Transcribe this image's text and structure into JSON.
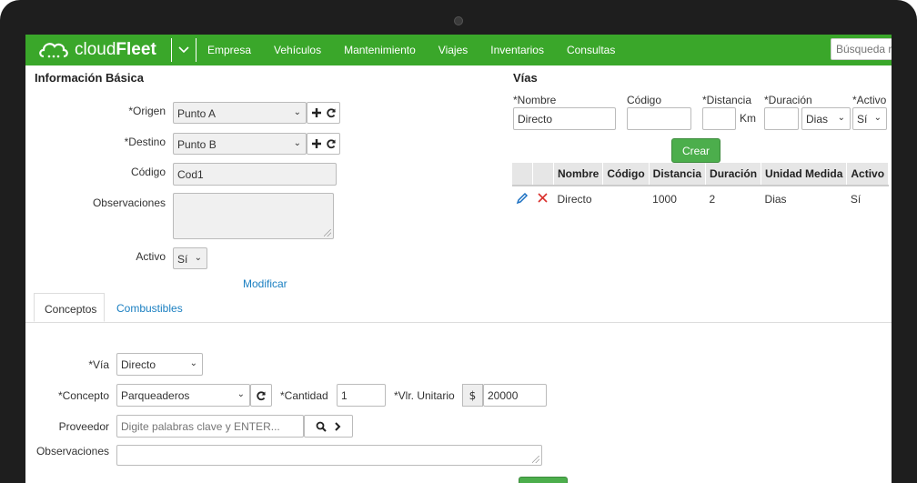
{
  "app": {
    "logo_text_light": "cloud",
    "logo_text_bold": "Fleet"
  },
  "nav": {
    "items": [
      "Empresa",
      "Vehículos",
      "Mantenimiento",
      "Viajes",
      "Inventarios",
      "Consultas"
    ],
    "search_placeholder": "Búsqueda r"
  },
  "basic": {
    "title": "Información Básica",
    "origen_label": "*Origen",
    "origen_value": "Punto A",
    "destino_label": "*Destino",
    "destino_value": "Punto B",
    "codigo_label": "Código",
    "codigo_value": "Cod1",
    "obs_label": "Observaciones",
    "obs_value": "",
    "activo_label": "Activo",
    "activo_value": "Sí",
    "modify_link": "Modificar"
  },
  "vias": {
    "title": "Vías",
    "nombre_label": "*Nombre",
    "nombre_value": "Directo",
    "codigo_label": "Código",
    "codigo_value": "",
    "distancia_label": "*Distancia",
    "distancia_value": "",
    "distancia_unit": "Km",
    "duracion_label": "*Duración",
    "duracion_value": "",
    "duracion_unit": "Dias",
    "activo_label": "*Activo",
    "activo_value": "Sí",
    "create_button": "Crear",
    "columns": [
      "",
      "",
      "Nombre",
      "Código",
      "Distancia",
      "Duración",
      "Unidad Medida",
      "Activo"
    ],
    "rows": [
      {
        "nombre": "Directo",
        "codigo": "",
        "distancia": "1000",
        "duracion": "2",
        "unidad": "Dias",
        "activo": "Sí"
      }
    ]
  },
  "tabs": {
    "active": "Conceptos",
    "other": "Combustibles"
  },
  "conceptos": {
    "via_label": "*Vía",
    "via_value": "Directo",
    "concepto_label": "*Concepto",
    "concepto_value": "Parqueaderos",
    "cantidad_label": "*Cantidad",
    "cantidad_value": "1",
    "vlr_label": "*Vlr. Unitario",
    "vlr_prefix": "$",
    "vlr_value": "20000",
    "proveedor_label": "Proveedor",
    "proveedor_placeholder": "Digite palabras clave y ENTER...",
    "obs_label": "Observaciones",
    "obs_value": ""
  },
  "colors": {
    "brand_green": "#3aa72a",
    "button_green": "#4cae4c",
    "link_blue": "#1a7fc1"
  }
}
